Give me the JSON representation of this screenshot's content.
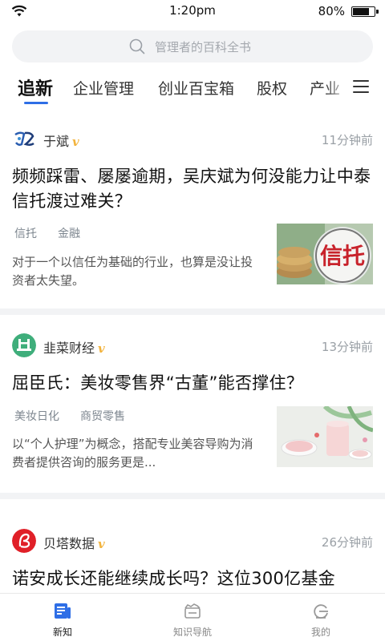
{
  "status_bar": {
    "time": "1:20pm",
    "battery": "80%",
    "battery_level": 0.8
  },
  "search": {
    "placeholder": "管理者的百科全书"
  },
  "tabs": [
    {
      "label": "追新",
      "active": true
    },
    {
      "label": "企业管理"
    },
    {
      "label": "创业百宝箱"
    },
    {
      "label": "股权"
    },
    {
      "label": "产业"
    }
  ],
  "articles": [
    {
      "source": "于斌",
      "verified_mark": "v",
      "time": "11分钟前",
      "title": "频频踩雷、屡屡逾期，吴庆斌为何没能力让中泰信托渡过难关？",
      "tags": [
        "信托",
        "金融"
      ],
      "summary": "对于一个以信任为基础的行业，也算是没让投资者太失望。",
      "thumb_text": "信托"
    },
    {
      "source": "韭菜财经",
      "verified_mark": "v",
      "time": "13分钟前",
      "title": "屈臣氏：美妆零售界“古董”能否撑住？",
      "tags": [
        "美妆日化",
        "商贸零售"
      ],
      "summary": "以“个人护理”为概念，搭配专业美容导购为消费者提供咨询的服务更是..."
    },
    {
      "source": "贝塔数据",
      "verified_mark": "v",
      "time": "26分钟前",
      "title": "诺安成长还能继续成长吗？这位300亿基金"
    }
  ],
  "bottom_nav": [
    {
      "label": "新知",
      "icon": "news-icon",
      "active": true
    },
    {
      "label": "知识导航",
      "icon": "knowledge-nav-icon"
    },
    {
      "label": "我的",
      "icon": "profile-icon"
    }
  ],
  "colors": {
    "accent": "#2e6ee6",
    "verified": "#f2b33d",
    "background_gray": "#f2f3f5"
  }
}
